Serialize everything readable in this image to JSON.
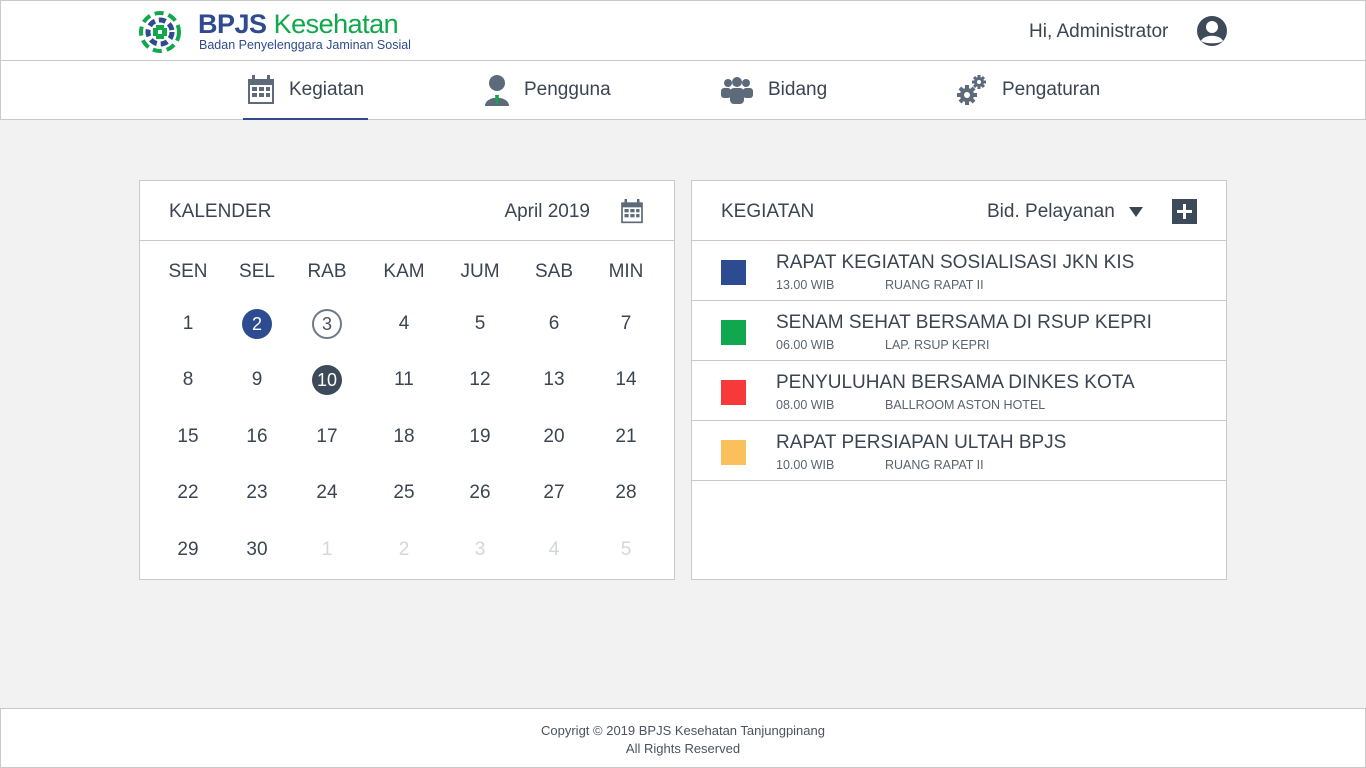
{
  "app": {
    "brand_primary": "BPJS",
    "brand_secondary": "Kesehatan",
    "tagline": "Badan Penyelenggara Jaminan Sosial",
    "greeting": "Hi, Administrator",
    "colors": {
      "navy": "#2f4a8d",
      "green": "#0fa84b",
      "dark": "#3d4a5a"
    }
  },
  "nav": {
    "items": [
      {
        "label": "Kegiatan",
        "icon": "calendar-icon",
        "active": true
      },
      {
        "label": "Pengguna",
        "icon": "user-icon",
        "active": false
      },
      {
        "label": "Bidang",
        "icon": "group-icon",
        "active": false
      },
      {
        "label": "Pengaturan",
        "icon": "gears-icon",
        "active": false
      }
    ]
  },
  "calendar": {
    "title": "KALENDER",
    "month": "April 2019",
    "weekdays": [
      "SEN",
      "SEL",
      "RAB",
      "KAM",
      "JUM",
      "SAB",
      "MIN"
    ],
    "weeks": [
      [
        "1",
        "2",
        "3",
        "4",
        "5",
        "6",
        "7"
      ],
      [
        "8",
        "9",
        "10",
        "11",
        "12",
        "13",
        "14"
      ],
      [
        "15",
        "16",
        "17",
        "18",
        "19",
        "20",
        "21"
      ],
      [
        "22",
        "23",
        "24",
        "25",
        "26",
        "27",
        "28"
      ],
      [
        "29",
        "30",
        "1",
        "2",
        "3",
        "4",
        "5"
      ]
    ],
    "highlight_blue": "2",
    "highlight_ring": "3",
    "highlight_dark": "10"
  },
  "activities": {
    "title": "KEGIATAN",
    "filter": "Bid. Pelayanan",
    "items": [
      {
        "title": "RAPAT KEGIATAN SOSIALISASI JKN KIS",
        "time": "13.00 WIB",
        "place": "RUANG RAPAT II",
        "color": "#2c4b90"
      },
      {
        "title": "SENAM SEHAT BERSAMA DI RSUP KEPRI",
        "time": "06.00 WIB",
        "place": "LAP. RSUP KEPRI",
        "color": "#10a84f"
      },
      {
        "title": "PENYULUHAN BERSAMA DINKES KOTA",
        "time": "08.00 WIB",
        "place": "BALLROOM ASTON HOTEL",
        "color": "#f73939"
      },
      {
        "title": "RAPAT PERSIAPAN ULTAH BPJS",
        "time": "10.00 WIB",
        "place": "RUANG RAPAT II",
        "color": "#f9c05b"
      }
    ]
  },
  "footer": {
    "line1": "Copyrigt © 2019 BPJS Kesehatan Tanjungpinang",
    "line2": "All Rights Reserved"
  }
}
